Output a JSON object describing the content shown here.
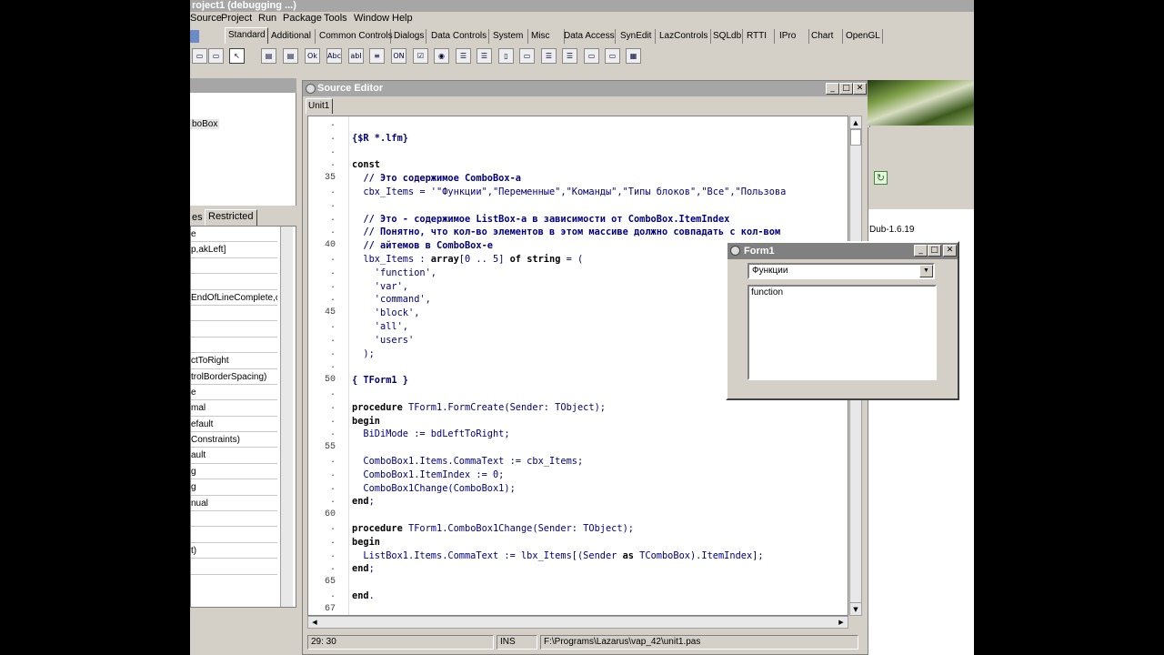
{
  "ide": {
    "title": "roject1 (debugging ...)",
    "menu": [
      "Source",
      "Project",
      "Run",
      "Package",
      "Tools",
      "Window",
      "Help"
    ],
    "palette_tabs": [
      "Standard",
      "Additional",
      "Common Controls",
      "Dialogs",
      "Data Controls",
      "System",
      "Misc",
      "Data Access",
      "SynEdit",
      "LazControls",
      "SQLdb",
      "RTTI",
      "IPro",
      "Chart",
      "OpenGL"
    ],
    "tool_icons": [
      "Ok",
      "Abc",
      "abI",
      "ON"
    ]
  },
  "left_panel": {
    "component_item": "boBox",
    "tabs": [
      "es",
      "Restricted"
    ],
    "rows": [
      "e",
      "p,akLeft]",
      "",
      "",
      "EndOfLineComplete,cb",
      "",
      "",
      "",
      "ctToRight",
      "trolBorderSpacing)",
      "e",
      "mal",
      "efault",
      "Constraints)",
      "ault",
      "g",
      "g",
      "nual",
      "",
      "",
      "t)",
      ""
    ]
  },
  "editor": {
    "title": "Source Editor",
    "tab": "Unit1",
    "lines": [
      {
        "n": "",
        "text": "",
        "m": "."
      },
      {
        "n": "",
        "text": "{$R *.lfm}",
        "m": "."
      },
      {
        "n": "",
        "text": "",
        "m": "."
      },
      {
        "n": "",
        "text": "const",
        "m": "."
      },
      {
        "n": "35",
        "text": "  // Это содержимое ComboBox-а",
        "m": ""
      },
      {
        "n": "",
        "text": "  cbx_Items = '\"Функции\",\"Переменные\",\"Команды\",\"Типы блоков\",\"Все\",\"Пользова",
        "m": "."
      },
      {
        "n": "",
        "text": "",
        "m": "."
      },
      {
        "n": "",
        "text": "  // Это - содержимое ListBox-а в зависимости от ComboBox.ItemIndex",
        "m": "."
      },
      {
        "n": "",
        "text": "  // Понятно, что кол-во элементов в этом массиве должно совпадать с кол-вом",
        "m": "."
      },
      {
        "n": "40",
        "text": "  // айтемов в ComboBox-е",
        "m": ""
      },
      {
        "n": "",
        "text": "  lbx_Items : array[0 .. 5] of string = (",
        "m": "."
      },
      {
        "n": "",
        "text": "    'function',",
        "m": "."
      },
      {
        "n": "",
        "text": "    'var',",
        "m": "."
      },
      {
        "n": "",
        "text": "    'command',",
        "m": "."
      },
      {
        "n": "45",
        "text": "    'block',",
        "m": ""
      },
      {
        "n": "",
        "text": "    'all',",
        "m": "."
      },
      {
        "n": "",
        "text": "    'users'",
        "m": "."
      },
      {
        "n": "",
        "text": "  );",
        "m": "."
      },
      {
        "n": "",
        "text": "",
        "m": "."
      },
      {
        "n": "50",
        "text": "{ TForm1 }",
        "m": ""
      },
      {
        "n": "",
        "text": "",
        "m": "."
      },
      {
        "n": "",
        "text": "procedure TForm1.FormCreate(Sender: TObject);",
        "m": "."
      },
      {
        "n": "",
        "text": "begin",
        "m": "."
      },
      {
        "n": "",
        "text": "  BiDiMode := bdLeftToRight;",
        "m": "."
      },
      {
        "n": "55",
        "text": "",
        "m": ""
      },
      {
        "n": "",
        "text": "  ComboBox1.Items.CommaText := cbx_Items;",
        "m": "."
      },
      {
        "n": "",
        "text": "  ComboBox1.ItemIndex := 0;",
        "m": "."
      },
      {
        "n": "",
        "text": "  ComboBox1Change(ComboBox1);",
        "m": "."
      },
      {
        "n": "",
        "text": "end;",
        "m": "."
      },
      {
        "n": "60",
        "text": "",
        "m": ""
      },
      {
        "n": "",
        "text": "procedure TForm1.ComboBox1Change(Sender: TObject);",
        "m": "."
      },
      {
        "n": "",
        "text": "begin",
        "m": "."
      },
      {
        "n": "",
        "text": "  ListBox1.Items.CommaText := lbx_Items[(Sender as TComboBox).ItemIndex];",
        "m": "."
      },
      {
        "n": "",
        "text": "end;",
        "m": "."
      },
      {
        "n": "65",
        "text": "",
        "m": ""
      },
      {
        "n": "",
        "text": "end.",
        "m": "."
      },
      {
        "n": "67",
        "text": "",
        "m": ""
      }
    ],
    "status": {
      "position": "29: 30",
      "mode": "INS",
      "file": "F:\\Programs\\Lazarus\\vap_42\\unit1.pas"
    }
  },
  "right_panel": {
    "item": "Dub-1.6.19"
  },
  "form1": {
    "title": "Form1",
    "combo_value": "Функции",
    "list_items": [
      "function"
    ]
  },
  "colors": {
    "keyword": "#000000",
    "code": "#000080",
    "titlebar_inactive": "#a6a6a6",
    "face": "#d4d0c8"
  }
}
